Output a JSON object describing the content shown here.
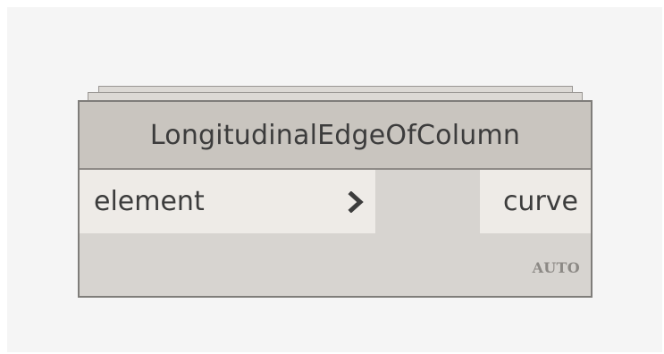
{
  "node": {
    "title": "LongitudinalEdgeOfColumn",
    "input_port_label": "element",
    "output_port_label": "curve",
    "lacing": "AUTO"
  },
  "icons": {
    "input_port_arrow": "chevron-right-icon"
  },
  "colors": {
    "workspace_bg": "#f5f5f5",
    "header_bg": "#c9c5bf",
    "body_bg": "#d7d4d0",
    "port_bg": "#eeebe7",
    "border": "#7f7d7a",
    "text": "#3c3c3c",
    "badge_text": "#8c8985"
  }
}
